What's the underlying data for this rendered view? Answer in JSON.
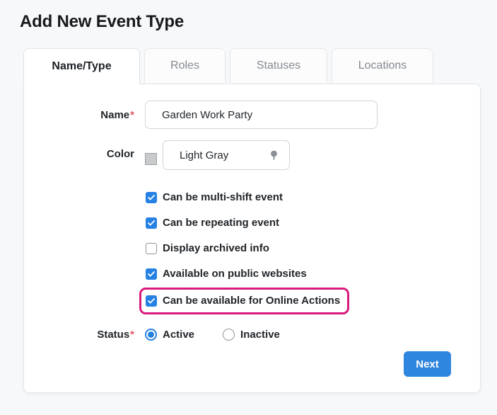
{
  "page": {
    "title": "Add New Event Type"
  },
  "tabs": [
    {
      "label": "Name/Type",
      "active": true
    },
    {
      "label": "Roles",
      "active": false
    },
    {
      "label": "Statuses",
      "active": false
    },
    {
      "label": "Locations",
      "active": false
    }
  ],
  "form": {
    "name_field": {
      "label": "Name",
      "required_mark": "*",
      "value": "Garden Work Party"
    },
    "color_field": {
      "label": "Color",
      "value": "Light Gray",
      "swatch_color": "#c9cacb",
      "icon": "tree-icon"
    },
    "checkboxes": [
      {
        "label": "Can be multi-shift event",
        "checked": true
      },
      {
        "label": "Can be repeating event",
        "checked": true
      },
      {
        "label": "Display archived info",
        "checked": false
      },
      {
        "label": "Available on public websites",
        "checked": true
      },
      {
        "label": "Can be available for Online Actions",
        "checked": true,
        "highlighted": true
      }
    ],
    "status_field": {
      "label": "Status",
      "required_mark": "*",
      "options": [
        {
          "label": "Active",
          "selected": true
        },
        {
          "label": "Inactive",
          "selected": false
        }
      ]
    },
    "next_button": "Next"
  },
  "colors": {
    "accent_blue": "#2581e4",
    "button_blue": "#2e86de",
    "highlight_pink": "#d91a7d",
    "page_background": "#f7f8f9",
    "required_red": "#e25563"
  }
}
